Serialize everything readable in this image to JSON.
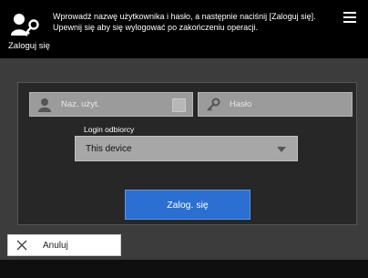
{
  "header": {
    "message_line1": "Wprowadź nazwę użytkownika i hasło, a następnie naciśnij [Zaloguj się].",
    "message_line2": "Upewnij się aby się wylogować po zakończeniu operacji.",
    "title": "Zaloguj się",
    "icons": {
      "login": "user-key-icon",
      "menu": "hamburger-menu-icon"
    }
  },
  "form": {
    "username_placeholder": "Naz. użyt.",
    "password_placeholder": "Hasło",
    "destination_label": "Login odbiorcy",
    "destination_value": "This device",
    "login_button": "Zalog. się",
    "icons": {
      "username": "user-icon",
      "password": "key-icon",
      "username_dropdown": "dropdown-icon",
      "destination_arrow": "chevron-down-icon"
    }
  },
  "footer": {
    "cancel_label": "Anuluj",
    "icons": {
      "cancel": "close-icon"
    }
  },
  "colors": {
    "header_bg": "#000000",
    "panel_bg": "#272727",
    "field_bg": "#9b9b9b",
    "primary_button": "#2a6fd1"
  }
}
